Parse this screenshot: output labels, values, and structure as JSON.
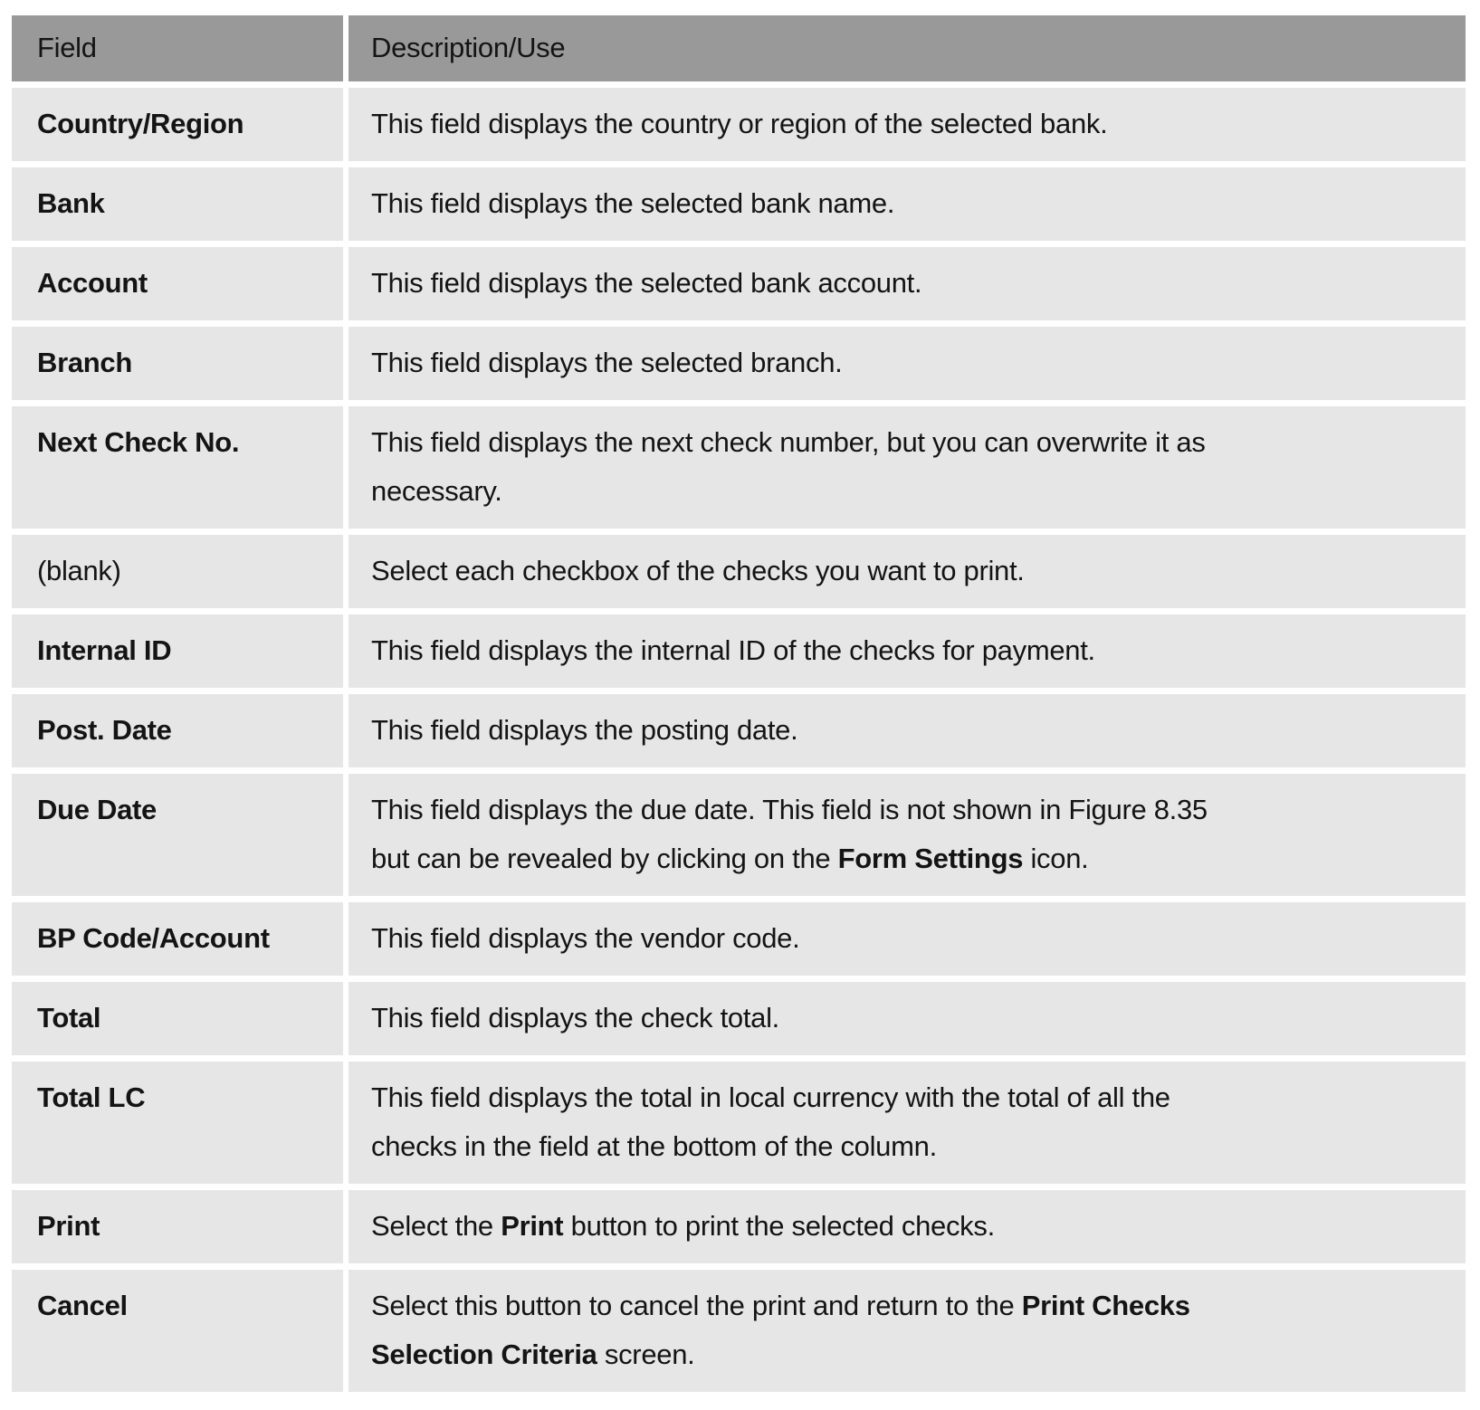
{
  "table": {
    "headers": [
      "Field",
      "Description/Use"
    ],
    "rows": [
      {
        "field": "Country/Region",
        "bold": true,
        "lines": [
          [
            {
              "t": "This field displays the country or region of the selected bank."
            }
          ]
        ]
      },
      {
        "field": "Bank",
        "bold": true,
        "lines": [
          [
            {
              "t": "This field displays the selected bank name."
            }
          ]
        ]
      },
      {
        "field": "Account",
        "bold": true,
        "lines": [
          [
            {
              "t": "This field displays the selected bank account."
            }
          ]
        ]
      },
      {
        "field": "Branch",
        "bold": true,
        "lines": [
          [
            {
              "t": "This field displays the selected branch."
            }
          ]
        ]
      },
      {
        "field": "Next Check No.",
        "bold": true,
        "lines": [
          [
            {
              "t": "This field displays the next check number, but you can overwrite it as"
            }
          ],
          [
            {
              "t": "necessary."
            }
          ]
        ]
      },
      {
        "field": "(blank)",
        "bold": false,
        "lines": [
          [
            {
              "t": "Select each checkbox of the checks you want to print."
            }
          ]
        ]
      },
      {
        "field": "Internal ID",
        "bold": true,
        "lines": [
          [
            {
              "t": "This field displays the internal ID of the checks for payment."
            }
          ]
        ]
      },
      {
        "field": "Post. Date",
        "bold": true,
        "lines": [
          [
            {
              "t": "This field displays the posting date."
            }
          ]
        ]
      },
      {
        "field": "Due Date",
        "bold": true,
        "lines": [
          [
            {
              "t": "This field displays the due date. This field is not shown in Figure 8.35"
            }
          ],
          [
            {
              "t": "but can be revealed by clicking on the "
            },
            {
              "t": "Form Settings",
              "b": true
            },
            {
              "t": " icon."
            }
          ]
        ]
      },
      {
        "field": "BP Code/Account",
        "bold": true,
        "lines": [
          [
            {
              "t": "This field displays the vendor code."
            }
          ]
        ]
      },
      {
        "field": "Total",
        "bold": true,
        "lines": [
          [
            {
              "t": "This field displays the check total."
            }
          ]
        ]
      },
      {
        "field": "Total LC",
        "bold": true,
        "lines": [
          [
            {
              "t": "This field displays the total in local currency with the total of all the"
            }
          ],
          [
            {
              "t": "checks in the field at the bottom of the column."
            }
          ]
        ]
      },
      {
        "field": "Print",
        "bold": true,
        "lines": [
          [
            {
              "t": "Select the "
            },
            {
              "t": "Print",
              "b": true
            },
            {
              "t": " button to print the selected checks."
            }
          ]
        ]
      },
      {
        "field": "Cancel",
        "bold": true,
        "lines": [
          [
            {
              "t": "Select this button to cancel the print and return to the "
            },
            {
              "t": "Print Checks",
              "b": true
            }
          ],
          [
            {
              "t": "Selection Criteria",
              "b": true
            },
            {
              "t": " screen."
            }
          ]
        ]
      }
    ]
  }
}
